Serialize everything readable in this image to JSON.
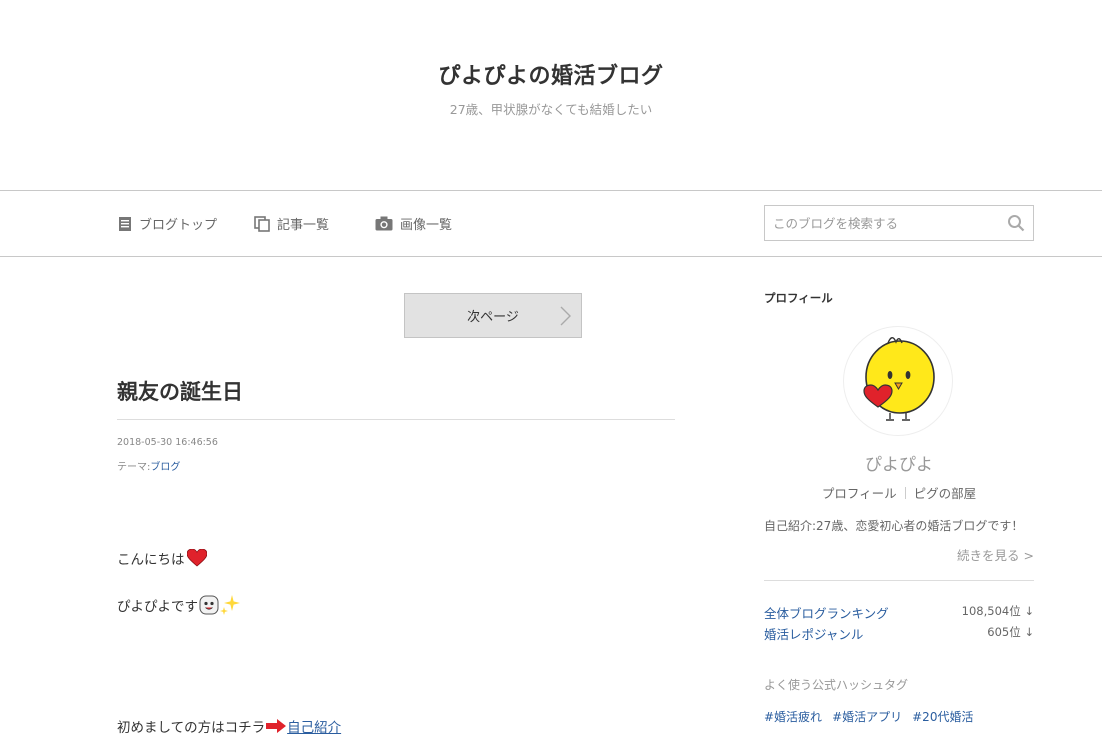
{
  "header": {
    "title": "ぴよぴよの婚活ブログ",
    "subtitle": "27歳、甲状腺がなくても結婚したい"
  },
  "nav": {
    "items": [
      {
        "label": "ブログトップ",
        "icon": "document-icon"
      },
      {
        "label": "記事一覧",
        "icon": "copy-icon"
      },
      {
        "label": "画像一覧",
        "icon": "camera-icon"
      }
    ],
    "search_placeholder": "このブログを検索する"
  },
  "pager": {
    "next_label": "次ページ"
  },
  "article": {
    "title": "親友の誕生日",
    "date": "2018-05-30 16:46:56",
    "theme_label": "テーマ:",
    "theme_value": "ブログ",
    "lines": [
      "こんにちは",
      "ぴよぴよです",
      "初めましての方はコチラ"
    ],
    "intro_link": "自己紹介"
  },
  "sidebar": {
    "profile_heading": "プロフィール",
    "name": "ぴよぴよ",
    "profile_link": "プロフィール",
    "pig_link": "ピグの部屋",
    "intro": "自己紹介:27歳、恋愛初心者の婚活ブログです！",
    "more": "続きを見る >",
    "rankings": [
      {
        "label": "全体ブログランキング",
        "value": "108,504位 ↓"
      },
      {
        "label": "婚活レポジャンル",
        "value": "605位 ↓"
      }
    ],
    "hashtag_heading": "よく使う公式ハッシュタグ",
    "hashtags": [
      "#婚活疲れ",
      "#婚活アプリ",
      "#20代婚活"
    ]
  },
  "colors": {
    "link": "#2a5d9f",
    "heart": "#e0222b",
    "chick": "#ffe81a"
  }
}
